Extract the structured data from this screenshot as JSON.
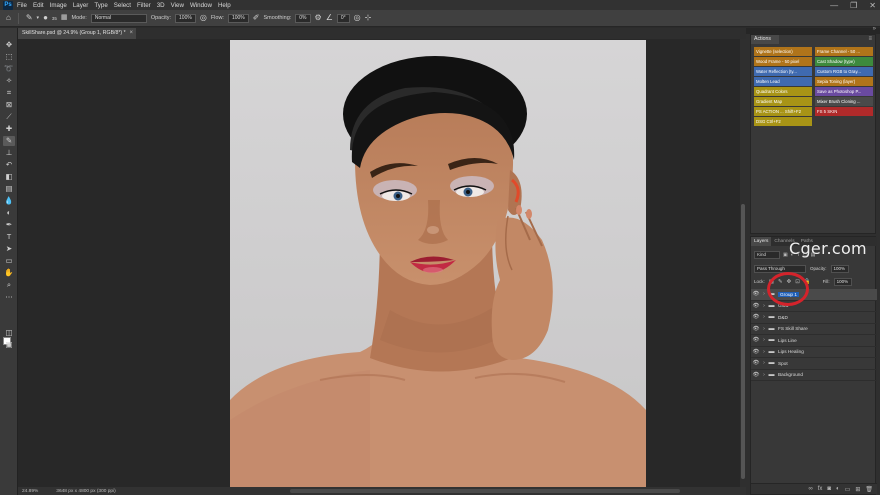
{
  "app": {
    "logo": "Ps"
  },
  "menu": [
    "File",
    "Edit",
    "Image",
    "Layer",
    "Type",
    "Select",
    "Filter",
    "3D",
    "View",
    "Window",
    "Help"
  ],
  "window_controls": {
    "minimize": "—",
    "maximize": "❐",
    "close": "✕"
  },
  "options_bar": {
    "brush_size": "35",
    "mode_label": "Mode:",
    "mode_value": "Normal",
    "opacity_label": "Opacity:",
    "opacity_value": "100%",
    "flow_label": "Flow:",
    "flow_value": "100%",
    "smoothing_label": "Smoothing:",
    "smoothing_value": "0%",
    "angle_value": "0°"
  },
  "document": {
    "tab_title": "SkillShare.psd @ 24.9% (Group 1, RGB/8*) *",
    "tab_close": "×"
  },
  "status": {
    "zoom": "24.89%",
    "doc_size": "3648 px x 4800 px (300 ppi)"
  },
  "actions_panel": {
    "tab_label": "Actions",
    "menu_glyph": "≡",
    "buttons": [
      {
        "label": "Vignette (selection)",
        "color": "#b0741a"
      },
      {
        "label": "Frame Channel - 50 ...",
        "color": "#b0741a"
      },
      {
        "label": "Wood Frame - 50 pixel",
        "color": "#b0741a"
      },
      {
        "label": "Cast Shadow (type)",
        "color": "#3d8a3d"
      },
      {
        "label": "Water Reflection (ty...",
        "color": "#3f6ab0"
      },
      {
        "label": "Custom RGB to Gray...",
        "color": "#3f6ab0"
      },
      {
        "label": "Molten Lead",
        "color": "#3f6ab0"
      },
      {
        "label": "Sepia Toning (layer)",
        "color": "#b0741a"
      },
      {
        "label": "Quadrant Colors",
        "color": "#a89416"
      },
      {
        "label": "Save as Photoshop P...",
        "color": "#6a4aa0"
      },
      {
        "label": "Gradient Map",
        "color": "#a89416"
      },
      {
        "label": "Mixer Brush Cloning ...",
        "color": "#4a4a4a"
      },
      {
        "label": "PS ACTION ...   Shift+F2",
        "color": "#a89416"
      },
      {
        "label": "FS 5 SKIN",
        "color": "#b02a2a"
      },
      {
        "label": "DSG          Ctrl+F2",
        "color": "#a89416"
      }
    ]
  },
  "layers_panel": {
    "tabs": [
      "Layers",
      "Channels",
      "Paths"
    ],
    "watermark": "Cger.com",
    "kind_label": "Kind",
    "blend_mode": "Pass Through",
    "opacity_label": "Opacity:",
    "opacity_value": "100%",
    "lock_label": "Lock:",
    "fill_label": "Fill:",
    "fill_value": "100%",
    "layers": [
      {
        "name": "Group 1",
        "selected": true,
        "editing": true
      },
      {
        "name": "Glow",
        "selected": false,
        "editing": false
      },
      {
        "name": "D&D",
        "selected": false,
        "editing": false
      },
      {
        "name": "FS Skill Share",
        "selected": false,
        "editing": false
      },
      {
        "name": "Lips Line",
        "selected": false,
        "editing": false
      },
      {
        "name": "Lips Healing",
        "selected": false,
        "editing": false
      },
      {
        "name": "Spot",
        "selected": false,
        "editing": false
      },
      {
        "name": "Background",
        "selected": false,
        "editing": false
      }
    ]
  }
}
